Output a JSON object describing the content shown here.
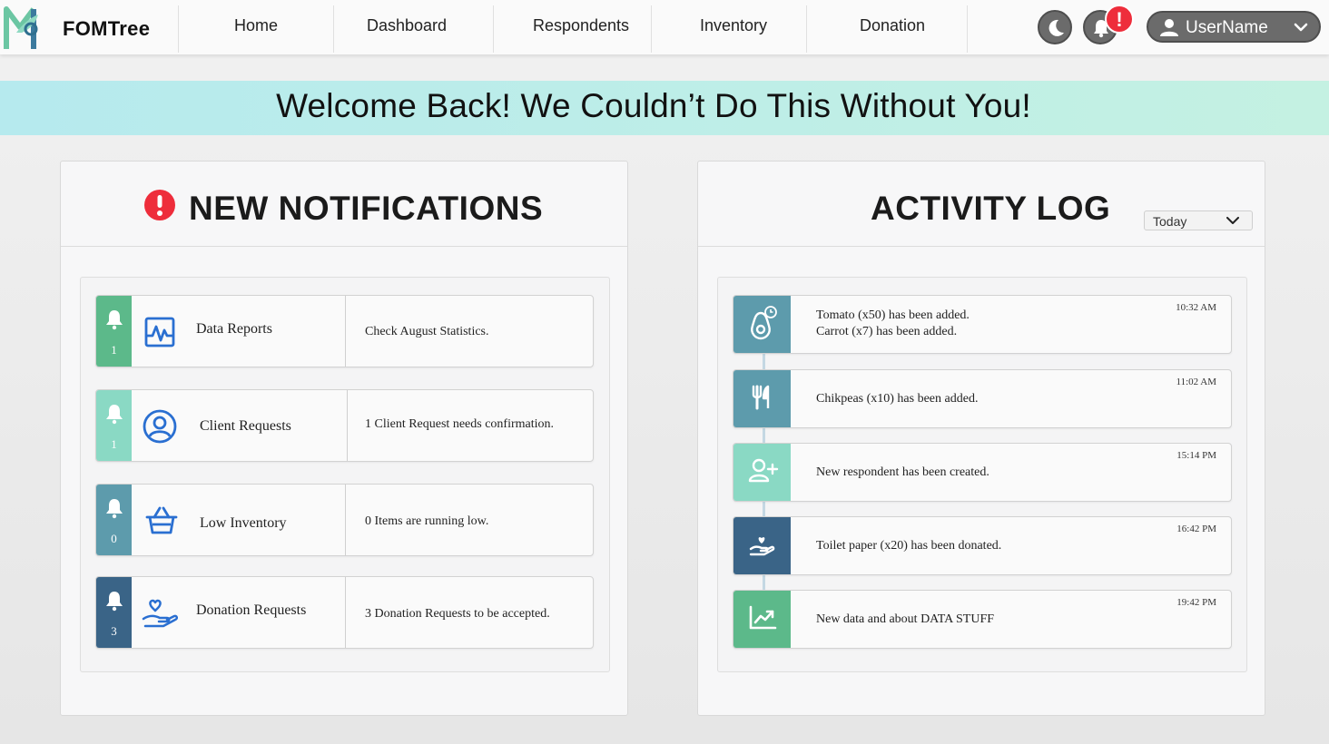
{
  "nav": {
    "brand": "FOMTree",
    "items": [
      "Home",
      "Dashboard",
      "Respondents",
      "Inventory",
      "Donation"
    ],
    "alert_badge": "!",
    "user_name": "UserName"
  },
  "banner": {
    "text": "Welcome Back! We Couldn’t Do This Without You!"
  },
  "notifications": {
    "title": "NEW NOTIFICATIONS",
    "items": [
      {
        "label": "Data Reports",
        "count": "1",
        "desc": "Check August Statistics.",
        "color": "#5cb98a",
        "icon": "heartbeat-chart-icon"
      },
      {
        "label": "Client Requests",
        "count": "1",
        "desc": "1 Client Request needs confirmation.",
        "color": "#8ad9c4",
        "icon": "user-circle-icon"
      },
      {
        "label": "Low Inventory",
        "count": "0",
        "desc": "0 Items are running low.",
        "color": "#5d9bac",
        "icon": "basket-icon"
      },
      {
        "label": "Donation Requests",
        "count": "3",
        "desc": "3 Donation Requests to be accepted.",
        "color": "#3a6487",
        "icon": "heart-hand-icon"
      }
    ]
  },
  "activity": {
    "title": "ACTIVITY LOG",
    "filter": "Today",
    "items": [
      {
        "lines": [
          "Tomato (x50) has been added.",
          "Carrot (x7) has been added."
        ],
        "time": "10:32 AM",
        "color": "#5d9bac",
        "icon": "avocado-clock-icon"
      },
      {
        "lines": [
          "Chikpeas (x10) has been added."
        ],
        "time": "11:02 AM",
        "color": "#5d9bac",
        "icon": "utensils-icon"
      },
      {
        "lines": [
          "New respondent has been created."
        ],
        "time": "15:14 PM",
        "color": "#8ad9c4",
        "icon": "user-plus-icon"
      },
      {
        "lines": [
          "Toilet paper (x20) has been donated."
        ],
        "time": "16:42 PM",
        "color": "#3a6487",
        "icon": "heart-hand-icon"
      },
      {
        "lines": [
          "New data and about DATA STUFF"
        ],
        "time": "19:42 PM",
        "color": "#5cb98a",
        "icon": "chart-up-icon"
      }
    ]
  }
}
